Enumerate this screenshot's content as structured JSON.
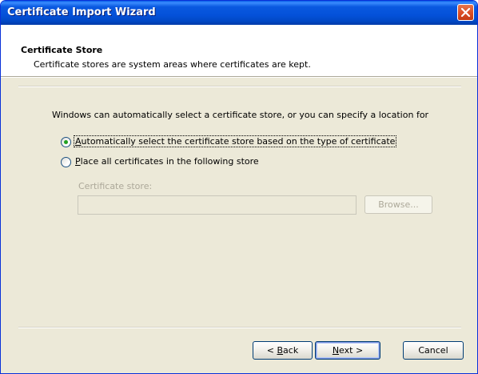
{
  "window": {
    "title": "Certificate Import Wizard"
  },
  "header": {
    "title": "Certificate Store",
    "subtitle": "Certificate stores are system areas where certificates are kept."
  },
  "content": {
    "intro": "Windows can automatically select a certificate store, or you can specify a location for",
    "options": [
      {
        "label_access_key": "A",
        "label_rest": "utomatically select the certificate store based on the type of certificate",
        "selected": true
      },
      {
        "label_access_key": "P",
        "label_rest": "lace all certificates in the following store",
        "selected": false
      }
    ],
    "store_label": "Certificate store:",
    "store_value": "",
    "browse_label": "Browse..."
  },
  "footer": {
    "back_prefix": "< ",
    "back_key": "B",
    "back_rest": "ack",
    "next_key": "N",
    "next_rest": "ext >",
    "cancel_label": "Cancel"
  },
  "colors": {
    "titlebar": "#0451d9",
    "close": "#dc5027",
    "dialog_bg": "#ece9d8",
    "radio_dot": "#21a121"
  },
  "icons": {
    "close": "close-icon"
  }
}
